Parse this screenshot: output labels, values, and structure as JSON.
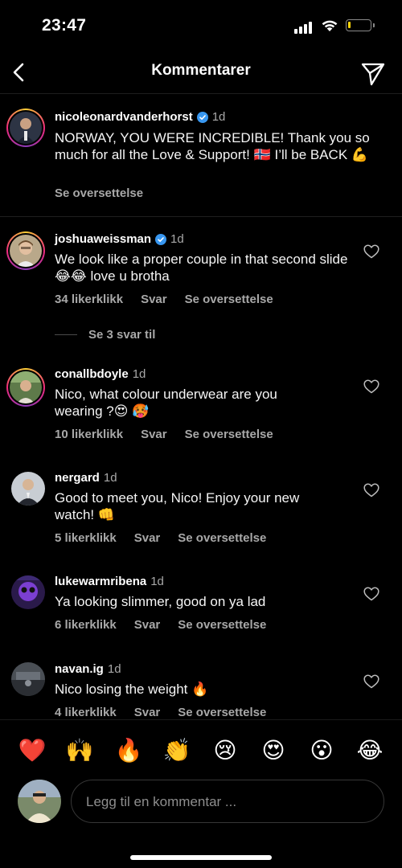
{
  "status_bar": {
    "time": "23:47",
    "battery_level": 0.1,
    "battery_color": "#ffd60a"
  },
  "nav": {
    "title": "Kommentarer",
    "back_icon": "chevron-left-icon",
    "send_icon": "paper-plane-icon"
  },
  "caption": {
    "username": "nicoleonardvanderhorst",
    "verified": true,
    "age": "1d",
    "text": "NORWAY, YOU WERE INCREDIBLE! Thank you so much for all the Love & Support! 🇳🇴 I’ll be BACK 💪",
    "translate": "Se oversettelse"
  },
  "comments": [
    {
      "username": "joshuaweissman",
      "verified": true,
      "age": "1d",
      "text": "We look like a proper couple in that second slide 😂😂 love u brotha",
      "likes": "34 likerklikk",
      "reply": "Svar",
      "translate": "Se oversettelse"
    },
    {
      "username": "conallbdoyle",
      "verified": false,
      "age": "1d",
      "text": "Nico, what colour underwear are you wearing ?😍 🥵",
      "likes": "10 likerklikk",
      "reply": "Svar",
      "translate": "Se oversettelse"
    },
    {
      "username": "nergard",
      "verified": false,
      "age": "1d",
      "text": "Good to meet you, Nico! Enjoy your new watch! 👊",
      "likes": "5 likerklikk",
      "reply": "Svar",
      "translate": "Se oversettelse"
    },
    {
      "username": "lukewarmribena",
      "verified": false,
      "age": "1d",
      "text": "Ya looking slimmer, good on ya lad",
      "likes": "6 likerklikk",
      "reply": "Svar",
      "translate": "Se oversettelse"
    },
    {
      "username": "navan.ig",
      "verified": false,
      "age": "1d",
      "text": "Nico losing the weight 🔥",
      "likes": "4 likerklikk",
      "reply": "Svar",
      "translate": "Se oversettelse"
    }
  ],
  "view_replies": "Se 3 svar til",
  "quick_reactions": [
    "❤️",
    "🙌",
    "🔥",
    "👏",
    "😢",
    "😍",
    "😮",
    "😂"
  ],
  "compose": {
    "placeholder": "Legg til en kommentar ..."
  }
}
